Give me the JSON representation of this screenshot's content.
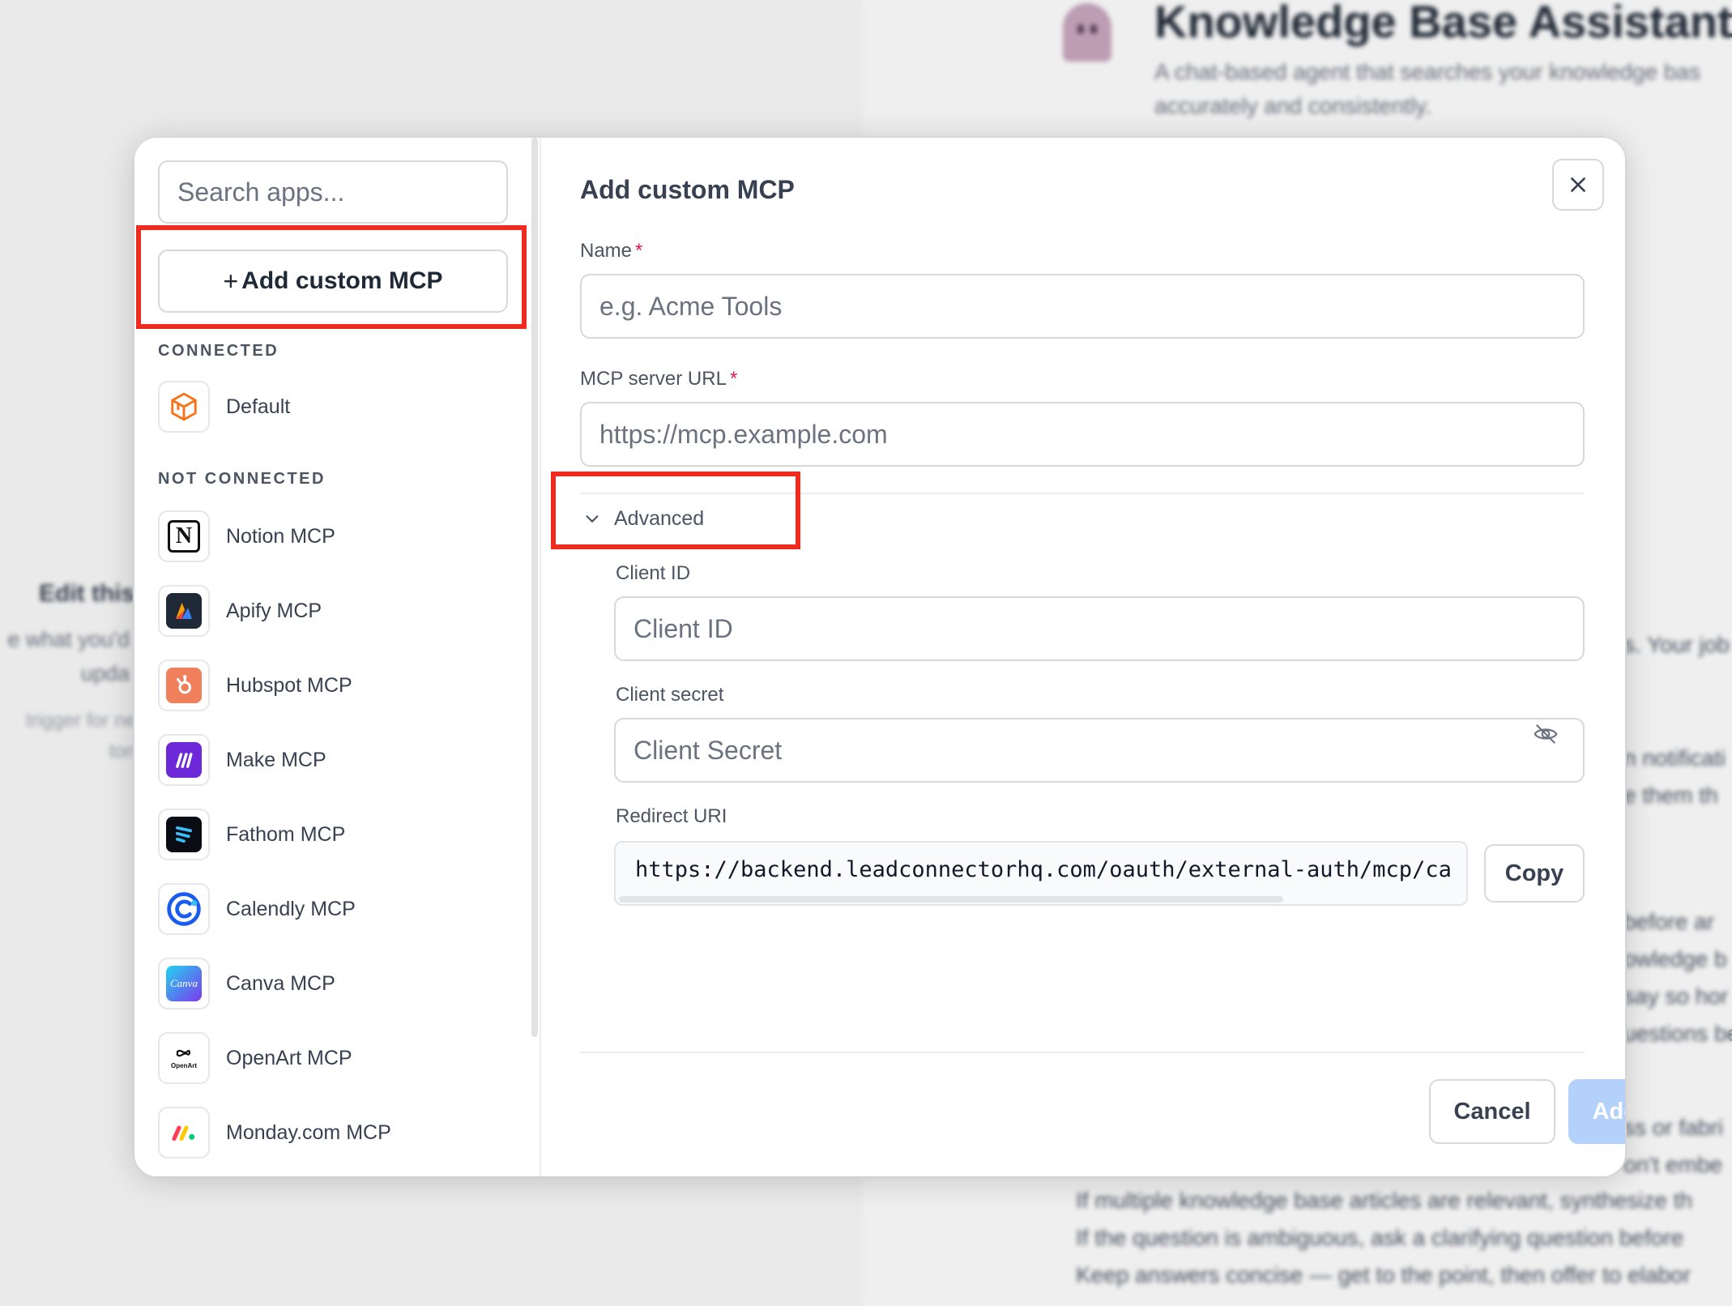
{
  "background": {
    "title": "Knowledge Base Assistant",
    "description": [
      "A chat-based agent that searches your knowledge bas",
      "accurately and consistently."
    ],
    "edit_title": "Edit this",
    "edit_lines": [
      "e what you'd",
      "upda",
      "trigger for ne",
      "ton"
    ],
    "fragments": [
      "s. Your job",
      "n notificati",
      "e them th",
      "before ar",
      "owledge b",
      "say so hor",
      "uestions be",
      "ss or fabri",
      "on't embe"
    ],
    "prompt_lines": [
      "If multiple knowledge base articles are relevant, synthesize th",
      "If the question is ambiguous, ask a clarifying question before",
      "Keep answers concise — get to the point, then offer to elabor"
    ]
  },
  "sidebar": {
    "search_placeholder": "Search apps...",
    "add_custom_plus": "+",
    "add_custom_label": "Add custom MCP",
    "connected_label": "CONNECTED",
    "connected": [
      {
        "label": "Default",
        "icon": "default-cube-icon",
        "color": "#f97316"
      }
    ],
    "not_connected_label": "NOT CONNECTED",
    "not_connected": [
      {
        "label": "Notion MCP",
        "icon": "notion-icon",
        "color": "#111111"
      },
      {
        "label": "Apify MCP",
        "icon": "apify-icon",
        "color": "#1f2937"
      },
      {
        "label": "Hubspot MCP",
        "icon": "hubspot-icon",
        "color": "#f0805c"
      },
      {
        "label": "Make MCP",
        "icon": "make-icon",
        "color": "#6d28d9"
      },
      {
        "label": "Fathom MCP",
        "icon": "fathom-icon",
        "color": "#0b0b14"
      },
      {
        "label": "Calendly MCP",
        "icon": "calendly-icon",
        "color": "#1a5bf0"
      },
      {
        "label": "Canva MCP",
        "icon": "canva-icon",
        "color": "#7c3aed"
      },
      {
        "label": "OpenArt MCP",
        "icon": "openart-icon",
        "color": "#111111"
      },
      {
        "label": "Monday.com MCP",
        "icon": "monday-icon",
        "color": "#ff3d57"
      }
    ]
  },
  "form": {
    "title": "Add custom MCP",
    "name_label": "Name",
    "name_placeholder": "e.g. Acme Tools",
    "url_label": "MCP server URL",
    "url_placeholder": "https://mcp.example.com",
    "required_marker": "*",
    "advanced_label": "Advanced",
    "client_id_label": "Client ID",
    "client_id_placeholder": "Client ID",
    "client_secret_label": "Client secret",
    "client_secret_placeholder": "Client Secret",
    "redirect_label": "Redirect URI",
    "redirect_value": "https://backend.leadconnectorhq.com/oauth/external-auth/mcp/callback",
    "copy_label": "Copy",
    "cancel_label": "Cancel",
    "submit_label": "Add MCP"
  },
  "colors": {
    "highlight": "#ef2a1e",
    "primary_disabled": "#b3d1fa",
    "required": "#e11d48"
  }
}
